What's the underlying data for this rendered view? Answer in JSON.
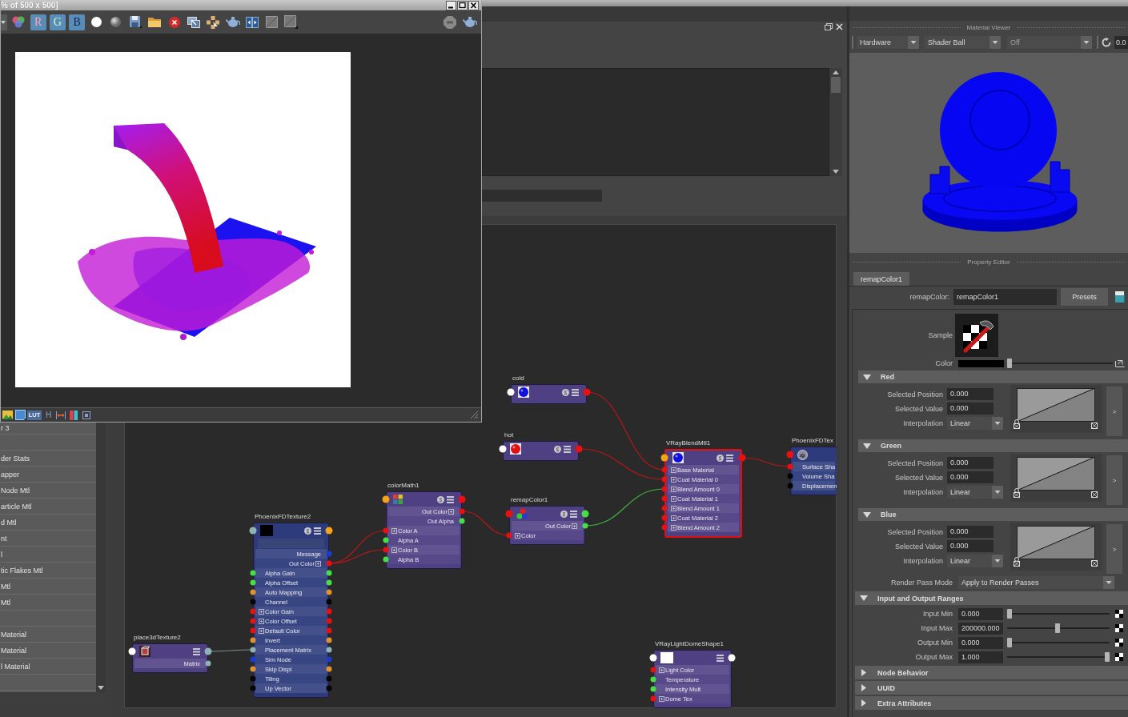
{
  "render_view": {
    "title": "% of 500 x 500]",
    "channel_buttons": [
      {
        "label": "R",
        "on": true
      },
      {
        "label": "G",
        "on": true
      },
      {
        "label": "B",
        "on": true
      }
    ],
    "lut_label": "LUT",
    "toolbar_glyph": "H"
  },
  "material_list": {
    "items": [
      {
        "kind": "text",
        "label": "r 3"
      },
      {
        "kind": "blank"
      },
      {
        "kind": "text",
        "label": "der Stats"
      },
      {
        "kind": "text",
        "label": "apper"
      },
      {
        "kind": "text",
        "label": "Node Mtl"
      },
      {
        "kind": "text",
        "label": "article Mtl"
      },
      {
        "kind": "text",
        "label": "d Mtl"
      },
      {
        "kind": "text",
        "label": "nt"
      },
      {
        "kind": "text",
        "label": "l"
      },
      {
        "kind": "text",
        "label": "tic Flakes Mtl"
      },
      {
        "kind": "text",
        "label": "Mtl"
      },
      {
        "kind": "text",
        "label": "Mtl"
      },
      {
        "kind": "blank"
      },
      {
        "kind": "text",
        "label": "Material"
      },
      {
        "kind": "text",
        "label": "Material"
      },
      {
        "kind": "text",
        "label": "l Material"
      },
      {
        "kind": "blank"
      }
    ]
  },
  "node_editor": {
    "nodes": [
      {
        "title": "place3dTexture2",
        "kind": "placement",
        "color": "#4f3f83",
        "selected": false,
        "header_ports": [
          {
            "kind": "input",
            "color": "#ffffff"
          },
          {
            "kind": "output",
            "color": "#8fb3b3"
          }
        ],
        "rows": [
          {
            "label": "Matrix",
            "kind": "output",
            "color": "#8fb3b3",
            "compound": false
          }
        ]
      },
      {
        "title": "PhoenixFDTexture2",
        "kind": "texture",
        "color": "#2d3b7c",
        "selected": false,
        "swatch": {
          "kind": "square",
          "color": "#000000"
        },
        "header_ports": [
          {
            "kind": "input",
            "color": "#8fb3b3"
          },
          {
            "kind": "output",
            "color": "#f5a316"
          }
        ],
        "rows": [
          {
            "label": "Message",
            "kind": "output",
            "color": "#1c3ccf",
            "compound": false
          },
          {
            "label": "Out Color",
            "kind": "output",
            "color": "#e81010",
            "compound": true
          },
          {
            "label": "Alpha Gain",
            "kind": "both",
            "color": "#46e046",
            "compound": false
          },
          {
            "label": "Alpha Offset",
            "kind": "both",
            "color": "#46e046",
            "compound": false
          },
          {
            "label": "Auto Mapping",
            "kind": "both",
            "color": "#e0922c",
            "compound": false
          },
          {
            "label": "Channel",
            "kind": "both",
            "color": "#050505",
            "compound": false
          },
          {
            "label": "Color Gain",
            "kind": "both",
            "color": "#e81010",
            "compound": true
          },
          {
            "label": "Color Offset",
            "kind": "both",
            "color": "#e81010",
            "compound": true
          },
          {
            "label": "Default Color",
            "kind": "both",
            "color": "#e81010",
            "compound": true
          },
          {
            "label": "Invert",
            "kind": "both",
            "color": "#e0922c",
            "compound": false
          },
          {
            "label": "Placement Matrix",
            "kind": "both",
            "color": "#8fb3b3",
            "compound": false
          },
          {
            "label": "Sim Node",
            "kind": "both",
            "color": "#1c3ccf",
            "compound": false
          },
          {
            "label": "Skip Displ",
            "kind": "both",
            "color": "#e0922c",
            "compound": false
          },
          {
            "label": "Tiling",
            "kind": "both",
            "color": "#050505",
            "compound": false
          },
          {
            "label": "Up Vector",
            "kind": "both",
            "color": "#050505",
            "compound": false
          }
        ]
      },
      {
        "title": "colorMath1",
        "kind": "math",
        "color": "#4f3f83",
        "selected": false,
        "header_ports": [
          {
            "kind": "input",
            "color": "#f5a316"
          },
          {
            "kind": "output",
            "color": "#e81010"
          }
        ],
        "rows": [
          {
            "label": "Out Color",
            "kind": "output",
            "color": "#e81010",
            "compound": true
          },
          {
            "label": "Out Alpha",
            "kind": "output",
            "color": "#46e046",
            "compound": false
          },
          {
            "label": "Color A",
            "kind": "input",
            "color": "#e81010",
            "compound": true
          },
          {
            "label": "Alpha A",
            "kind": "input",
            "color": "#46e046",
            "compound": false
          },
          {
            "label": "Color B",
            "kind": "input",
            "color": "#e81010",
            "compound": true
          },
          {
            "label": "Alpha B",
            "kind": "input",
            "color": "#46e046",
            "compound": false
          }
        ]
      },
      {
        "title": "cold",
        "kind": "material",
        "color": "#4f3f83",
        "selected": false,
        "swatch": {
          "kind": "sphere",
          "color": "#1010e0"
        },
        "header_ports": [
          {
            "kind": "input",
            "color": "#ffffff"
          },
          {
            "kind": "output",
            "color": "#e81010"
          }
        ]
      },
      {
        "title": "hot",
        "kind": "material",
        "color": "#4f3f83",
        "selected": false,
        "swatch": {
          "kind": "sphere",
          "color": "#e01010"
        },
        "header_ports": [
          {
            "kind": "input",
            "color": "#ffffff"
          },
          {
            "kind": "output",
            "color": "#e81010"
          }
        ]
      },
      {
        "title": "remapColor1",
        "kind": "remap",
        "color": "#4f3f83",
        "selected": false,
        "header_ports": [
          {
            "kind": "input",
            "color": "#e81010"
          },
          {
            "kind": "output",
            "color": "#46e046"
          }
        ],
        "rows": [
          {
            "label": "Out Color",
            "kind": "output",
            "color": "#46e046",
            "compound": true
          },
          {
            "label": "Color",
            "kind": "input",
            "color": "#e81010",
            "compound": true
          }
        ]
      },
      {
        "title": "VRayBlendMtl1",
        "kind": "material",
        "color": "#4f3f83",
        "selected": true,
        "swatch": {
          "kind": "sphere",
          "color": "#1010e0"
        },
        "header_ports": [
          {
            "kind": "input",
            "color": "#f5a316"
          },
          {
            "kind": "output",
            "color": "#e81010"
          }
        ],
        "rows": [
          {
            "label": "Base Material",
            "kind": "input",
            "color": "#e81010",
            "compound": true
          },
          {
            "label": "Coat Material 0",
            "kind": "input",
            "color": "#e81010",
            "compound": true
          },
          {
            "label": "Blend Amount 0",
            "kind": "input",
            "color": "#e81010",
            "compound": true
          },
          {
            "label": "Coat Material 1",
            "kind": "input",
            "color": "#e81010",
            "compound": true
          },
          {
            "label": "Blend Amount 1",
            "kind": "input",
            "color": "#e81010",
            "compound": true
          },
          {
            "label": "Coat Material 2",
            "kind": "input",
            "color": "#e81010",
            "compound": true
          },
          {
            "label": "Blend Amount 2",
            "kind": "input",
            "color": "#e81010",
            "compound": true
          }
        ]
      },
      {
        "title": "PhoenixFDTex",
        "kind": "shading_group",
        "color": "#2d3b7c",
        "selected": false,
        "header_ports": [
          {
            "kind": "input",
            "color": "#e81010"
          }
        ],
        "rows": [
          {
            "label": "Surface Sha",
            "kind": "input",
            "color": "#e81010",
            "compound": false
          },
          {
            "label": "Volume Sha",
            "kind": "input",
            "color": "#050505",
            "compound": false
          },
          {
            "label": "Displacemen",
            "kind": "input",
            "color": "#050505",
            "compound": false
          }
        ]
      },
      {
        "title": "VRayLightDomeShape1",
        "kind": "light",
        "color": "#4f3f83",
        "selected": false,
        "swatch": {
          "kind": "square",
          "color": "#ffffff"
        },
        "header_ports": [
          {
            "kind": "input",
            "color": "#ffffff"
          },
          {
            "kind": "output",
            "color": "#ffffff"
          }
        ],
        "rows": [
          {
            "label": "Light Color",
            "kind": "input",
            "color": "#e81010",
            "compound": true
          },
          {
            "label": "Temperature",
            "kind": "input",
            "color": "#46e046",
            "compound": false
          },
          {
            "label": "Intensity Mult",
            "kind": "input",
            "color": "#46e046",
            "compound": false
          },
          {
            "label": "Dome Tex",
            "kind": "input",
            "color": "#e81010",
            "compound": true
          }
        ]
      }
    ]
  },
  "material_viewer": {
    "title": "Material Viewer",
    "renderer": "Hardware",
    "geometry": "Shader Ball",
    "environment": {
      "value": "Off",
      "disabled": true
    },
    "exposure": "0.0"
  },
  "property_editor": {
    "title": "Property Editor",
    "tabs": [
      {
        "label": "remapColor1",
        "selected": true
      }
    ],
    "type_label": "remapColor:",
    "name_value": "remapColor1",
    "presets": "Presets",
    "sample_label": "Sample",
    "color_row": {
      "label": "Color",
      "color": "#000000",
      "level": 0
    },
    "items": [
      {
        "kind": "ramp",
        "title": "Red",
        "expanded": true,
        "fields": [
          {
            "label": "Selected Position",
            "value": "0.000"
          },
          {
            "label": "Selected Value",
            "value": "0.000"
          }
        ],
        "interpolation": {
          "label": "Interpolation",
          "value": "Linear"
        },
        "more": ">"
      },
      {
        "kind": "ramp",
        "title": "Green",
        "expanded": true,
        "fields": [
          {
            "label": "Selected Position",
            "value": "0.000"
          },
          {
            "label": "Selected Value",
            "value": "0.000"
          }
        ],
        "interpolation": {
          "label": "Interpolation",
          "value": "Linear"
        },
        "more": ">"
      },
      {
        "kind": "ramp",
        "title": "Blue",
        "expanded": true,
        "fields": [
          {
            "label": "Selected Position",
            "value": "0.000"
          },
          {
            "label": "Selected Value",
            "value": "0.000"
          }
        ],
        "interpolation": {
          "label": "Interpolation",
          "value": "Linear"
        },
        "more": ">"
      },
      {
        "kind": "dropdown",
        "label": "Render Pass Mode",
        "value": "Apply to Render Passes"
      },
      {
        "kind": "sliders",
        "title": "Input and Output Ranges",
        "expanded": true,
        "rows": [
          {
            "label": "Input Min",
            "value": "0.000",
            "level": 0
          },
          {
            "label": "Input Max",
            "value": "200000.000",
            "level": 0.49
          },
          {
            "label": "Output Min",
            "value": "0.000",
            "level": 0
          },
          {
            "label": "Output Max",
            "value": "1.000",
            "level": 1
          }
        ]
      },
      {
        "kind": "section",
        "title": "Node Behavior",
        "expanded": false
      },
      {
        "kind": "section",
        "title": "UUID",
        "expanded": false
      },
      {
        "kind": "section",
        "title": "Extra Attributes",
        "expanded": false
      }
    ]
  }
}
